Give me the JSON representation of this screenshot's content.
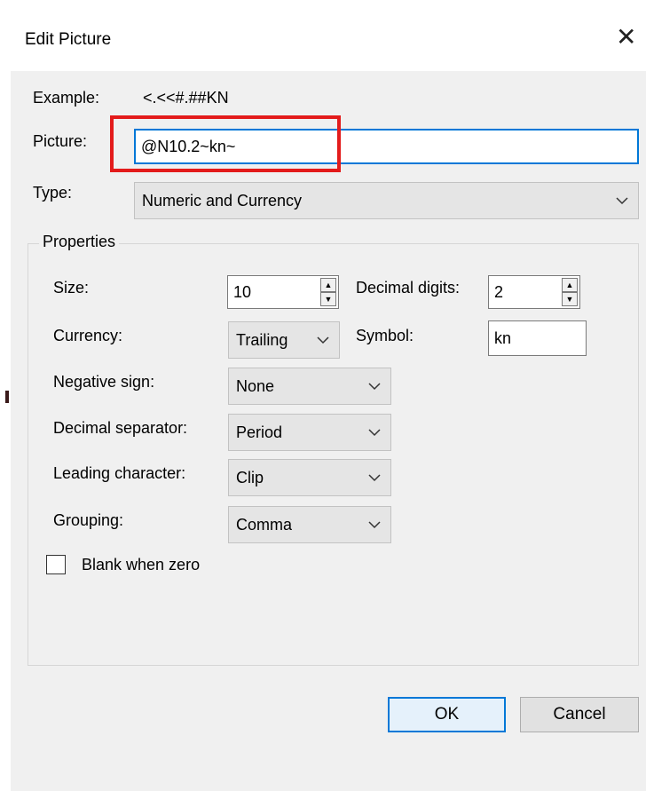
{
  "dialog": {
    "title": "Edit Picture",
    "close_icon": "close-icon",
    "example_label": "Example:",
    "example_value": "<.<<#.##KN",
    "picture_label": "Picture:",
    "picture_value": "@N10.2~kn~",
    "type_label": "Type:",
    "type_value": "Numeric and Currency"
  },
  "properties": {
    "title": "Properties",
    "size_label": "Size:",
    "size_value": "10",
    "decimal_digits_label": "Decimal digits:",
    "decimal_digits_value": "2",
    "currency_label": "Currency:",
    "currency_value": "Trailing",
    "symbol_label": "Symbol:",
    "symbol_value": "kn",
    "negative_sign_label": "Negative sign:",
    "negative_sign_value": "None",
    "decimal_separator_label": "Decimal separator:",
    "decimal_separator_value": "Period",
    "leading_character_label": "Leading character:",
    "leading_character_value": "Clip",
    "grouping_label": "Grouping:",
    "grouping_value": "Comma",
    "blank_when_zero_label": "Blank when zero",
    "blank_when_zero_checked": false
  },
  "buttons": {
    "ok": "OK",
    "cancel": "Cancel"
  },
  "colors": {
    "highlight": "#e31b1b",
    "focus": "#0078d7"
  }
}
